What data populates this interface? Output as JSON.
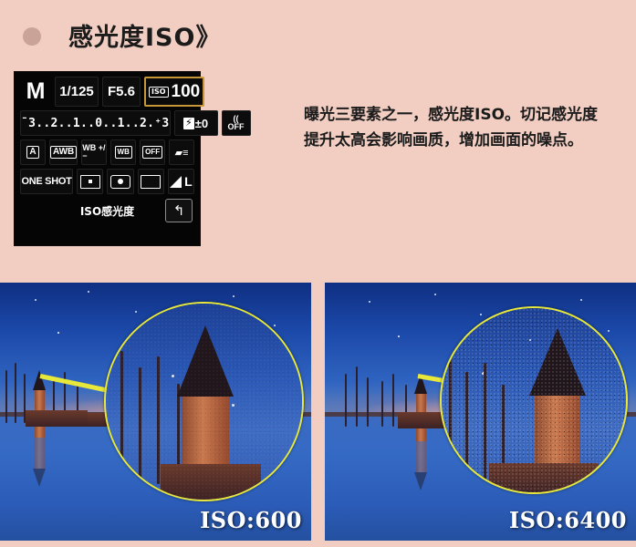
{
  "page": {
    "background_color": "#f2cec2",
    "title": "感光度ISO》"
  },
  "header": {
    "bullet_color": "#c9a397",
    "title": "感光度ISO》"
  },
  "camera_lcd": {
    "background_color": "#050505",
    "highlight_border_color": "#c8973a",
    "shooting_mode": "M",
    "shutter_speed": "1/125",
    "aperture": "F5.6",
    "iso_badge": "ISO",
    "iso_value": "100",
    "exposure_scale": "¯3..2..1..0..1..2.⁺3",
    "flash_exposure_comp_badge": "⚡",
    "flash_exposure_comp_value": "±0",
    "wireless_top": "((",
    "wireless_bottom": "OFF",
    "picture_style": "A",
    "white_balance": "AWB",
    "wb_shift": "WB +/−",
    "wb_bracket": "WB",
    "lens_correction": "OFF",
    "custom_controls": "▰≡",
    "af_mode": "ONE SHOT",
    "drive_mode": "single",
    "metering_mode": "evaluative",
    "af_area": "single-point",
    "image_quality": "L",
    "caption": "ISO感光度",
    "back_button": "↰"
  },
  "description": {
    "text": "曝光三要素之一，感光度ISO。切记感光度提升太高会影响画质，增加画面的噪点。"
  },
  "photos": [
    {
      "iso_label": "ISO:600",
      "noise_level": "low",
      "magnifier_ring_color": "#e8e83a",
      "pointer_color": "#e8e83a"
    },
    {
      "iso_label": "ISO:6400",
      "noise_level": "high",
      "magnifier_ring_color": "#e8e83a",
      "pointer_color": "#e8e83a"
    }
  ]
}
